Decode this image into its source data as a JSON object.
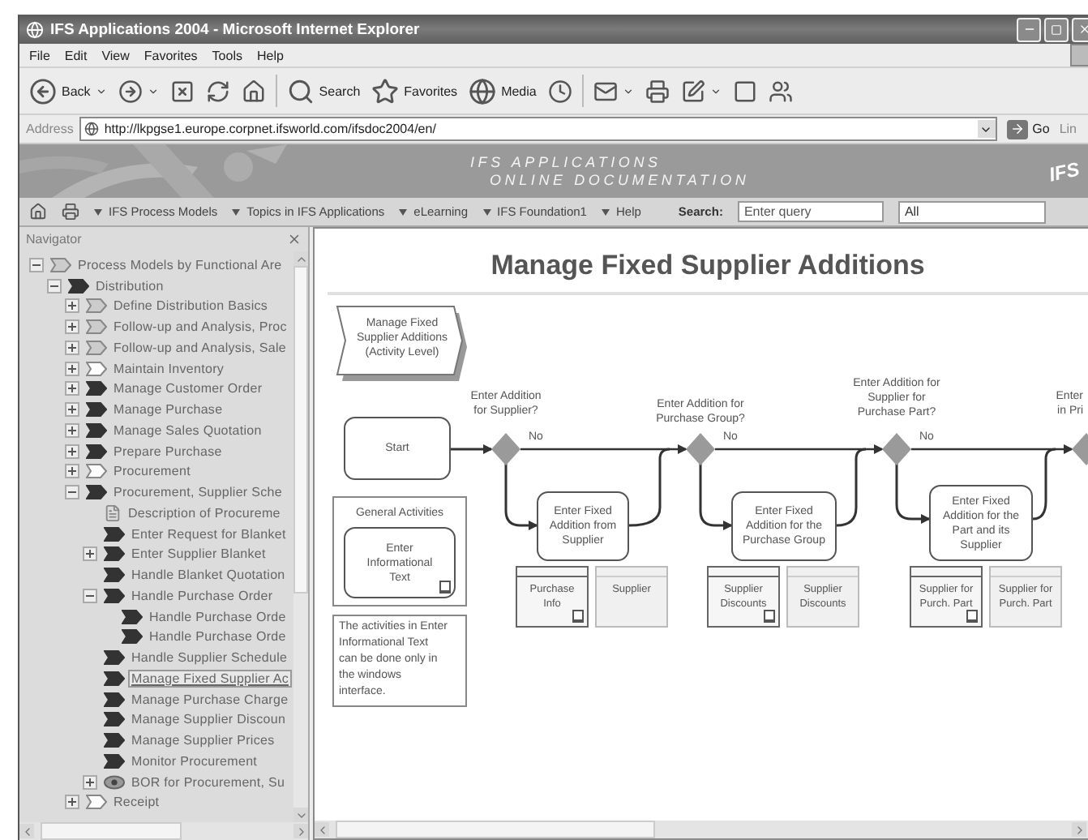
{
  "window": {
    "title": "IFS Applications 2004 - Microsoft Internet Explorer"
  },
  "menu": [
    "File",
    "Edit",
    "View",
    "Favorites",
    "Tools",
    "Help"
  ],
  "toolbar": [
    {
      "kind": "back",
      "label": "Back",
      "has_menu": true
    },
    {
      "kind": "forward",
      "has_menu": true
    },
    {
      "kind": "stop",
      "has_menu": false
    },
    {
      "kind": "refresh",
      "has_menu": false
    },
    {
      "kind": "home",
      "has_menu": false
    },
    {
      "kind": "search",
      "label": "Search",
      "has_menu": false
    },
    {
      "kind": "favorites",
      "label": "Favorites",
      "has_menu": false
    },
    {
      "kind": "media",
      "label": "Media",
      "has_menu": false
    },
    {
      "kind": "history",
      "has_menu": false
    },
    {
      "kind": "mail",
      "has_menu": true
    },
    {
      "kind": "print",
      "has_menu": false
    },
    {
      "kind": "edit",
      "has_menu": true
    },
    {
      "kind": "discuss",
      "has_menu": false
    },
    {
      "kind": "messenger",
      "has_menu": false
    }
  ],
  "address": {
    "label": "Address",
    "url": "http://lkpgse1.europe.corpnet.ifsworld.com/ifsdoc2004/en/",
    "go": "Go",
    "links": "Lin"
  },
  "banner": {
    "line1": "IFS APPLICATIONS",
    "line2": "ONLINE DOCUMENTATION",
    "logo": "IFS"
  },
  "nav": {
    "items": [
      "IFS Process Models",
      "Topics in IFS Applications",
      "eLearning",
      "IFS Foundation1",
      "Help"
    ],
    "search_label": "Search:",
    "search": {
      "placeholder": "Enter query"
    },
    "scope": "All"
  },
  "navigator": {
    "title": "Navigator",
    "tree": [
      {
        "label": "Process Models by Functional Are",
        "kind": "outline",
        "expanded": true,
        "selected": false,
        "children": [
          {
            "label": "Distribution",
            "kind": "filled",
            "expanded": true,
            "selected": false,
            "children": [
              {
                "label": "Define Distribution Basics",
                "kind": "outline",
                "expanded": false,
                "selected": false
              },
              {
                "label": "Follow-up and Analysis, Proc",
                "kind": "outline",
                "expanded": false,
                "selected": false
              },
              {
                "label": "Follow-up and Analysis, Sale",
                "kind": "outline",
                "expanded": false,
                "selected": false
              },
              {
                "label": "Maintain Inventory",
                "kind": "white",
                "expanded": false,
                "selected": false
              },
              {
                "label": "Manage Customer Order",
                "kind": "filled",
                "expanded": false,
                "selected": false
              },
              {
                "label": "Manage Purchase",
                "kind": "filled",
                "expanded": false,
                "selected": false
              },
              {
                "label": "Manage Sales Quotation",
                "kind": "filled",
                "expanded": false,
                "selected": false
              },
              {
                "label": "Prepare Purchase",
                "kind": "filled",
                "expanded": false,
                "selected": false
              },
              {
                "label": "Procurement",
                "kind": "white",
                "expanded": false,
                "selected": false
              },
              {
                "label": "Procurement, Supplier Sche",
                "kind": "filled",
                "expanded": true,
                "selected": false,
                "children": [
                  {
                    "label": "Description of Procureme",
                    "kind": "doc",
                    "selected": false
                  },
                  {
                    "label": "Enter Request for Blanket",
                    "kind": "filled",
                    "selected": false
                  },
                  {
                    "label": "Enter Supplier Blanket",
                    "kind": "filled",
                    "expanded": false,
                    "selected": false
                  },
                  {
                    "label": "Handle Blanket Quotation",
                    "kind": "filled",
                    "selected": false
                  },
                  {
                    "label": "Handle Purchase Order",
                    "kind": "filled",
                    "expanded": true,
                    "selected": false,
                    "children": [
                      {
                        "label": "Handle Purchase Orde",
                        "kind": "filled",
                        "selected": false
                      },
                      {
                        "label": "Handle Purchase Orde",
                        "kind": "filled",
                        "selected": false
                      }
                    ]
                  },
                  {
                    "label": "Handle Supplier Schedule",
                    "kind": "filled",
                    "selected": false
                  },
                  {
                    "label": "Manage Fixed Supplier Ac",
                    "kind": "filled",
                    "selected": true
                  },
                  {
                    "label": "Manage Purchase Charge",
                    "kind": "filled",
                    "selected": false
                  },
                  {
                    "label": "Manage Supplier Discoun",
                    "kind": "filled",
                    "selected": false
                  },
                  {
                    "label": "Manage Supplier Prices",
                    "kind": "filled",
                    "selected": false
                  },
                  {
                    "label": "Monitor Procurement",
                    "kind": "filled",
                    "selected": false
                  },
                  {
                    "label": "BOR for Procurement, Su",
                    "kind": "eye",
                    "expanded": false,
                    "selected": false
                  }
                ]
              },
              {
                "label": "Receipt",
                "kind": "white",
                "expanded": false,
                "selected": false
              }
            ]
          }
        ]
      }
    ]
  },
  "diagram": {
    "title": "Manage Fixed Supplier Additions",
    "process": "Manage Fixed\nSupplier Additions\n(Activity Level)",
    "start": "Start",
    "decisions": [
      {
        "question": "Enter Addition\nfor Supplier?",
        "branch": "No"
      },
      {
        "question": "Enter Addition for\nPurchase Group?",
        "branch": "No"
      },
      {
        "question": "Enter Addition for\nSupplier for\nPurchase Part?",
        "branch": "No"
      },
      {
        "question": "Enter\nin Pri"
      }
    ],
    "activities": [
      {
        "label": "Enter Fixed\nAddition from\nSupplier",
        "data": [
          {
            "label": "Purchase\nInfo",
            "linked": true
          },
          {
            "label": "Supplier",
            "linked": false
          }
        ]
      },
      {
        "label": "Enter Fixed\nAddition for the\nPurchase Group",
        "data": [
          {
            "label": "Supplier\nDiscounts",
            "linked": true
          },
          {
            "label": "Supplier\nDiscounts",
            "linked": false
          }
        ]
      },
      {
        "label": "Enter Fixed\nAddition for the\nPart and its\nSupplier",
        "data": [
          {
            "label": "Supplier for\nPurch. Part",
            "linked": true
          },
          {
            "label": "Supplier for\nPurch. Part",
            "linked": false
          }
        ]
      }
    ],
    "general": {
      "title": "General Activities",
      "activity": "Enter\nInformational\nText"
    },
    "note": "The activities in Enter\nInformational Text\ncan be done only in\nthe windows\ninterface."
  }
}
